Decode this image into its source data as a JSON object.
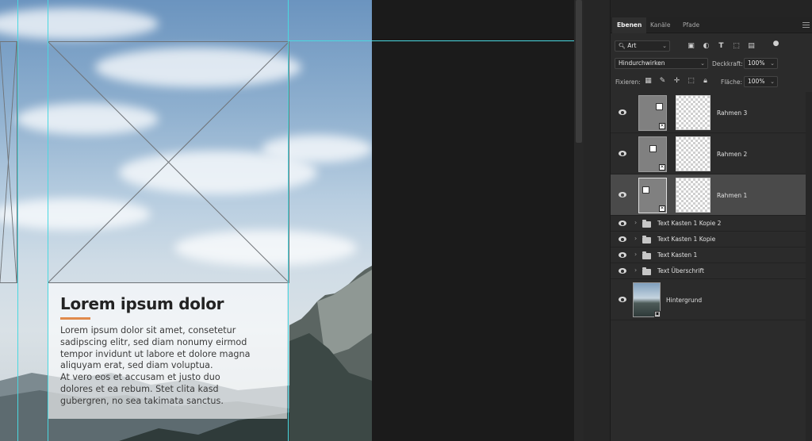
{
  "canvas": {
    "heading": "Lorem ipsum dolor",
    "body_lines": [
      "Lorem ipsum dolor sit amet, consetetur",
      "sadipscing elitr, sed diam nonumy eirmod",
      "tempor invidunt ut labore et dolore magna",
      "aliquyam erat, sed diam voluptua.",
      "At vero eos et accusam et justo duo",
      "dolores et ea rebum. Stet clita kasd",
      "gubergren, no sea takimata sanctus."
    ],
    "accent_color": "#e08a4c",
    "guide_color": "#4ad8e0"
  },
  "layers_panel": {
    "tabs": [
      "Ebenen",
      "Kanäle",
      "Pfade"
    ],
    "active_tab": "Ebenen",
    "filter": {
      "value": "Art",
      "icon": "search-icon"
    },
    "blend_mode": "Hindurchwirken",
    "opacity_label": "Deckkraft:",
    "opacity_value": "100%",
    "lock_label": "Fixieren:",
    "fill_label": "Fläche:",
    "fill_value": "100%",
    "layers": [
      {
        "name": "Rahmen 3",
        "type": "frame",
        "selected": false
      },
      {
        "name": "Rahmen 2",
        "type": "frame",
        "selected": false
      },
      {
        "name": "Rahmen 1",
        "type": "frame",
        "selected": true
      },
      {
        "name": "Text Kasten 1 Kopie 2",
        "type": "group",
        "selected": false
      },
      {
        "name": "Text Kasten 1 Kopie",
        "type": "group",
        "selected": false
      },
      {
        "name": "Text Kasten 1",
        "type": "group",
        "selected": false
      },
      {
        "name": "Text Überschrift",
        "type": "group",
        "selected": false
      },
      {
        "name": "Hintergrund",
        "type": "smart-object",
        "selected": false
      }
    ]
  }
}
